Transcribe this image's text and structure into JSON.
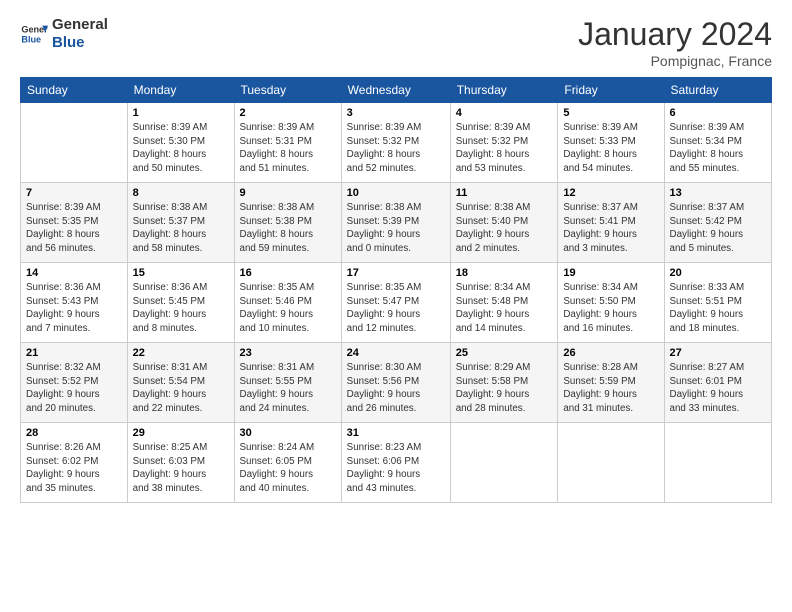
{
  "header": {
    "logo_line1": "General",
    "logo_line2": "Blue",
    "month_title": "January 2024",
    "location": "Pompignac, France"
  },
  "weekdays": [
    "Sunday",
    "Monday",
    "Tuesday",
    "Wednesday",
    "Thursday",
    "Friday",
    "Saturday"
  ],
  "weeks": [
    [
      {
        "day": "",
        "info": ""
      },
      {
        "day": "1",
        "info": "Sunrise: 8:39 AM\nSunset: 5:30 PM\nDaylight: 8 hours\nand 50 minutes."
      },
      {
        "day": "2",
        "info": "Sunrise: 8:39 AM\nSunset: 5:31 PM\nDaylight: 8 hours\nand 51 minutes."
      },
      {
        "day": "3",
        "info": "Sunrise: 8:39 AM\nSunset: 5:32 PM\nDaylight: 8 hours\nand 52 minutes."
      },
      {
        "day": "4",
        "info": "Sunrise: 8:39 AM\nSunset: 5:32 PM\nDaylight: 8 hours\nand 53 minutes."
      },
      {
        "day": "5",
        "info": "Sunrise: 8:39 AM\nSunset: 5:33 PM\nDaylight: 8 hours\nand 54 minutes."
      },
      {
        "day": "6",
        "info": "Sunrise: 8:39 AM\nSunset: 5:34 PM\nDaylight: 8 hours\nand 55 minutes."
      }
    ],
    [
      {
        "day": "7",
        "info": "Sunrise: 8:39 AM\nSunset: 5:35 PM\nDaylight: 8 hours\nand 56 minutes."
      },
      {
        "day": "8",
        "info": "Sunrise: 8:38 AM\nSunset: 5:37 PM\nDaylight: 8 hours\nand 58 minutes."
      },
      {
        "day": "9",
        "info": "Sunrise: 8:38 AM\nSunset: 5:38 PM\nDaylight: 8 hours\nand 59 minutes."
      },
      {
        "day": "10",
        "info": "Sunrise: 8:38 AM\nSunset: 5:39 PM\nDaylight: 9 hours\nand 0 minutes."
      },
      {
        "day": "11",
        "info": "Sunrise: 8:38 AM\nSunset: 5:40 PM\nDaylight: 9 hours\nand 2 minutes."
      },
      {
        "day": "12",
        "info": "Sunrise: 8:37 AM\nSunset: 5:41 PM\nDaylight: 9 hours\nand 3 minutes."
      },
      {
        "day": "13",
        "info": "Sunrise: 8:37 AM\nSunset: 5:42 PM\nDaylight: 9 hours\nand 5 minutes."
      }
    ],
    [
      {
        "day": "14",
        "info": "Sunrise: 8:36 AM\nSunset: 5:43 PM\nDaylight: 9 hours\nand 7 minutes."
      },
      {
        "day": "15",
        "info": "Sunrise: 8:36 AM\nSunset: 5:45 PM\nDaylight: 9 hours\nand 8 minutes."
      },
      {
        "day": "16",
        "info": "Sunrise: 8:35 AM\nSunset: 5:46 PM\nDaylight: 9 hours\nand 10 minutes."
      },
      {
        "day": "17",
        "info": "Sunrise: 8:35 AM\nSunset: 5:47 PM\nDaylight: 9 hours\nand 12 minutes."
      },
      {
        "day": "18",
        "info": "Sunrise: 8:34 AM\nSunset: 5:48 PM\nDaylight: 9 hours\nand 14 minutes."
      },
      {
        "day": "19",
        "info": "Sunrise: 8:34 AM\nSunset: 5:50 PM\nDaylight: 9 hours\nand 16 minutes."
      },
      {
        "day": "20",
        "info": "Sunrise: 8:33 AM\nSunset: 5:51 PM\nDaylight: 9 hours\nand 18 minutes."
      }
    ],
    [
      {
        "day": "21",
        "info": "Sunrise: 8:32 AM\nSunset: 5:52 PM\nDaylight: 9 hours\nand 20 minutes."
      },
      {
        "day": "22",
        "info": "Sunrise: 8:31 AM\nSunset: 5:54 PM\nDaylight: 9 hours\nand 22 minutes."
      },
      {
        "day": "23",
        "info": "Sunrise: 8:31 AM\nSunset: 5:55 PM\nDaylight: 9 hours\nand 24 minutes."
      },
      {
        "day": "24",
        "info": "Sunrise: 8:30 AM\nSunset: 5:56 PM\nDaylight: 9 hours\nand 26 minutes."
      },
      {
        "day": "25",
        "info": "Sunrise: 8:29 AM\nSunset: 5:58 PM\nDaylight: 9 hours\nand 28 minutes."
      },
      {
        "day": "26",
        "info": "Sunrise: 8:28 AM\nSunset: 5:59 PM\nDaylight: 9 hours\nand 31 minutes."
      },
      {
        "day": "27",
        "info": "Sunrise: 8:27 AM\nSunset: 6:01 PM\nDaylight: 9 hours\nand 33 minutes."
      }
    ],
    [
      {
        "day": "28",
        "info": "Sunrise: 8:26 AM\nSunset: 6:02 PM\nDaylight: 9 hours\nand 35 minutes."
      },
      {
        "day": "29",
        "info": "Sunrise: 8:25 AM\nSunset: 6:03 PM\nDaylight: 9 hours\nand 38 minutes."
      },
      {
        "day": "30",
        "info": "Sunrise: 8:24 AM\nSunset: 6:05 PM\nDaylight: 9 hours\nand 40 minutes."
      },
      {
        "day": "31",
        "info": "Sunrise: 8:23 AM\nSunset: 6:06 PM\nDaylight: 9 hours\nand 43 minutes."
      },
      {
        "day": "",
        "info": ""
      },
      {
        "day": "",
        "info": ""
      },
      {
        "day": "",
        "info": ""
      }
    ]
  ]
}
